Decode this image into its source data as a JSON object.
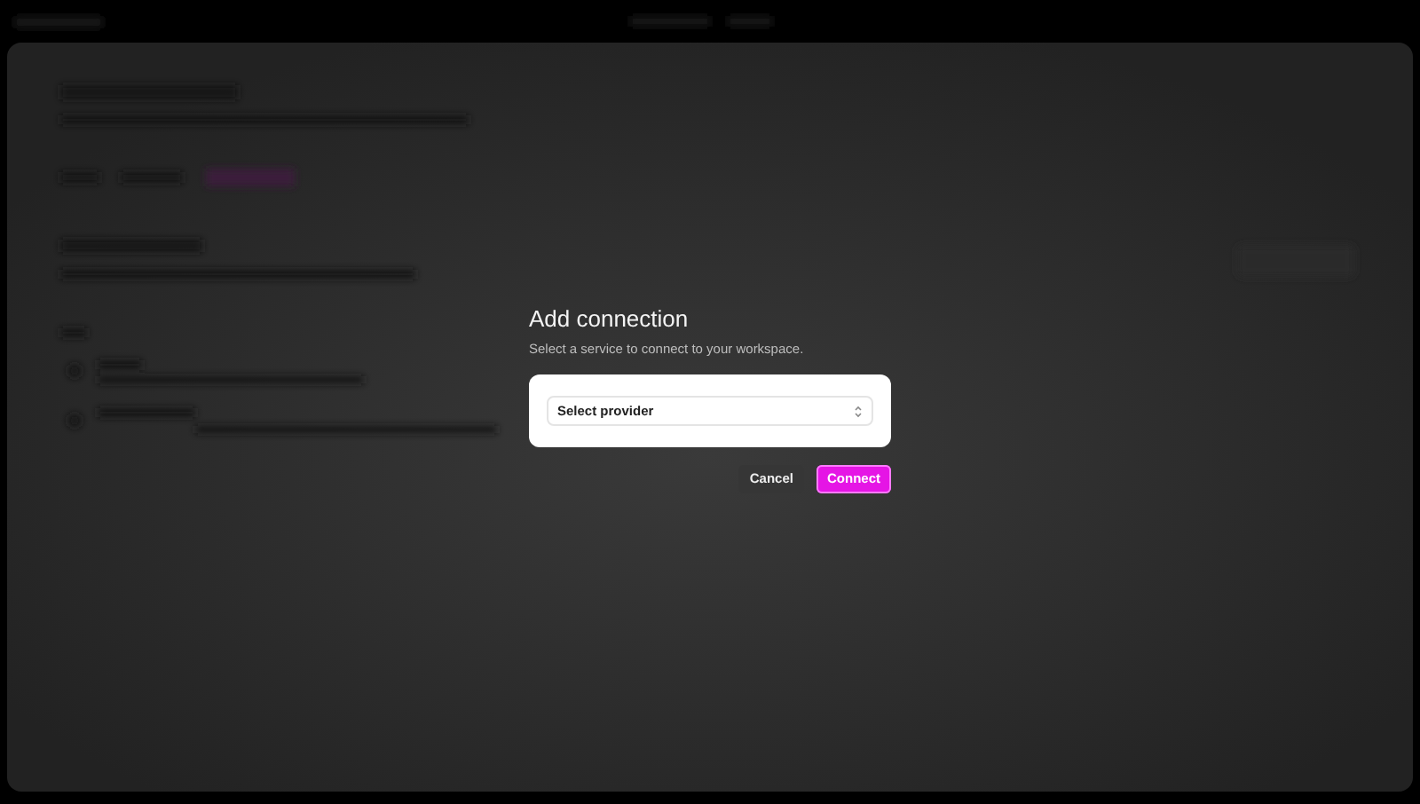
{
  "dialog": {
    "title": "Add connection",
    "subtitle": "Select a service to connect to your workspace.",
    "provider_select": {
      "placeholder": "Select provider"
    },
    "buttons": [
      {
        "label": "Cancel",
        "kind": "secondary"
      },
      {
        "label": "Connect",
        "kind": "primary"
      }
    ]
  }
}
